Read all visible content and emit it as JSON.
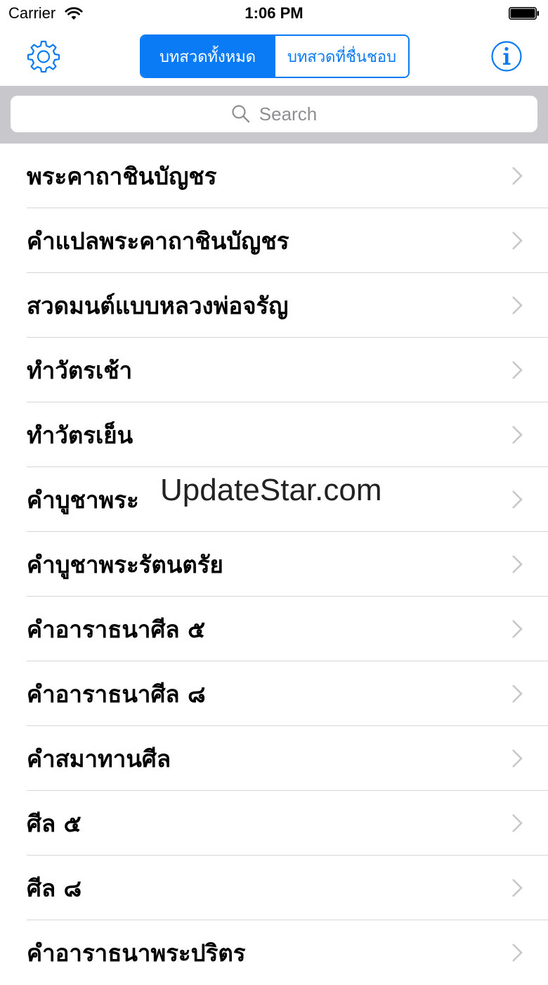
{
  "status_bar": {
    "carrier": "Carrier",
    "time": "1:06 PM"
  },
  "nav_bar": {
    "left_icon": "gear-icon",
    "right_icon": "info-icon",
    "segments": [
      "บทสวดทั้งหมด",
      "บทสวดที่ชื่นชอบ"
    ],
    "selected_segment": 0,
    "accent_color": "#0a7bf5"
  },
  "search": {
    "placeholder": "Search"
  },
  "list": {
    "items": [
      "พระคาถาชินบัญชร",
      "คำแปลพระคาถาชินบัญชร",
      "สวดมนต์แบบหลวงพ่อจรัญ",
      "ทำวัตรเช้า",
      "ทำวัตรเย็น",
      "คำบูชาพระ",
      "คำบูชาพระรัตนตรัย",
      "คำอาราธนาศีล ๕",
      "คำอาราธนาศีล ๘",
      "คำสมาทานศีล",
      "ศีล ๕",
      "ศีล ๘",
      "คำอาราธนาพระปริตร"
    ]
  },
  "watermark": "UpdateStar.com"
}
